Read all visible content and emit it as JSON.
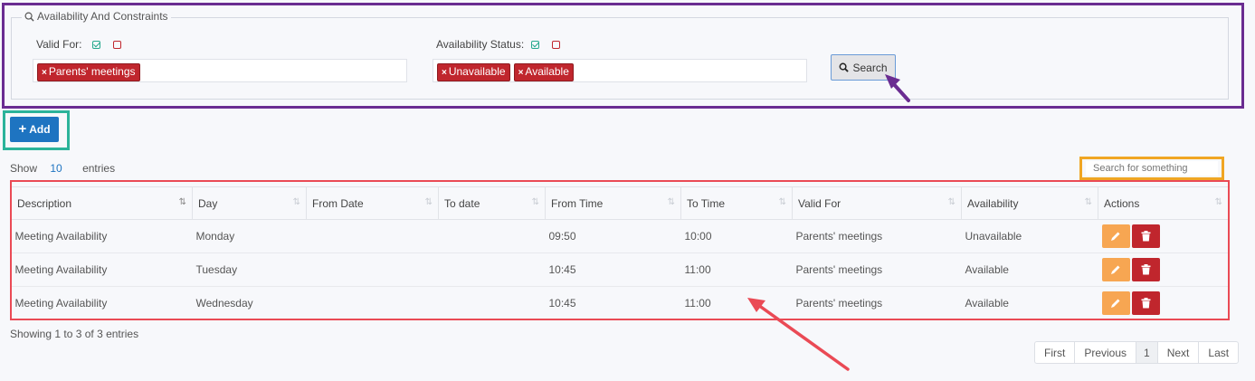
{
  "filters": {
    "legend": "Availability And Constraints",
    "valid_for": {
      "label": "Valid For:",
      "tags": [
        "Parents' meetings"
      ]
    },
    "availability_status": {
      "label": "Availability Status:",
      "tags": [
        "Unavailable",
        "Available"
      ]
    },
    "search_button": "Search"
  },
  "add_button": "Add",
  "length": {
    "show": "Show",
    "value": "10",
    "entries": "entries"
  },
  "search": {
    "placeholder": "Search for something"
  },
  "table": {
    "columns": [
      "Description",
      "Day",
      "From Date",
      "To date",
      "From Time",
      "To Time",
      "Valid For",
      "Availability",
      "Actions"
    ],
    "rows": [
      {
        "description": "Meeting Availability",
        "day": "Monday",
        "from_date": "",
        "to_date": "",
        "from_time": "09:50",
        "to_time": "10:00",
        "valid_for": "Parents' meetings",
        "availability": "Unavailable"
      },
      {
        "description": "Meeting Availability",
        "day": "Tuesday",
        "from_date": "",
        "to_date": "",
        "from_time": "10:45",
        "to_time": "11:00",
        "valid_for": "Parents' meetings",
        "availability": "Available"
      },
      {
        "description": "Meeting Availability",
        "day": "Wednesday",
        "from_date": "",
        "to_date": "",
        "from_time": "10:45",
        "to_time": "11:00",
        "valid_for": "Parents' meetings",
        "availability": "Available"
      }
    ]
  },
  "info": "Showing 1 to 3 of 3 entries",
  "pagination": {
    "first": "First",
    "previous": "Previous",
    "current": "1",
    "next": "Next",
    "last": "Last"
  },
  "icons": {
    "search": "search-icon",
    "plus": "plus-icon",
    "edit": "pencil-icon",
    "delete": "trash-icon",
    "sort": "sort-icon"
  },
  "colors": {
    "primary": "#1e74c1",
    "danger": "#c0262d",
    "warning": "#f7a652",
    "success": "#27a98e"
  }
}
